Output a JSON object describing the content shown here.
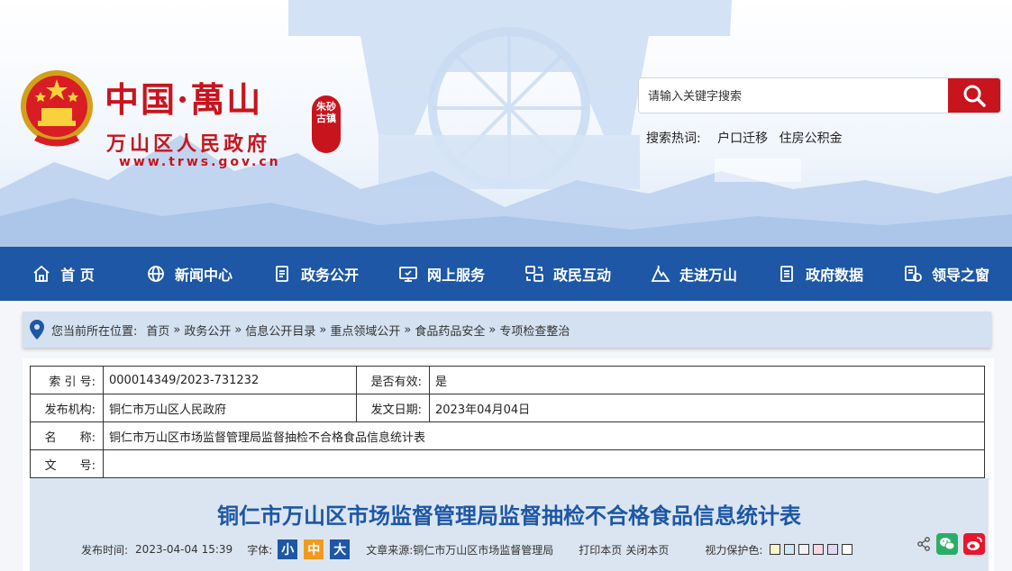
{
  "header": {
    "logo_title": "中国·萬山",
    "logo_seal": "朱砂古镇",
    "logo_subtitle": "万山区人民政府",
    "logo_url": "www.trws.gov.cn",
    "search": {
      "placeholder": "请输入关键字搜索",
      "hot_label": "搜索热词:",
      "hot_keywords": [
        "户口迁移",
        "住房公积金"
      ]
    }
  },
  "nav": {
    "items": [
      {
        "label": "首 页",
        "icon": "home-icon"
      },
      {
        "label": "新闻中心",
        "icon": "globe-icon"
      },
      {
        "label": "政务公开",
        "icon": "document-icon"
      },
      {
        "label": "网上服务",
        "icon": "monitor-icon"
      },
      {
        "label": "政民互动",
        "icon": "interaction-icon"
      },
      {
        "label": "走进万山",
        "icon": "mountain-icon"
      },
      {
        "label": "政府数据",
        "icon": "data-icon"
      },
      {
        "label": "领导之窗",
        "icon": "leader-icon"
      }
    ]
  },
  "breadcrumb": {
    "label": "您当前所在位置:",
    "items": [
      "首页",
      "政务公开",
      "信息公开目录",
      "重点领域公开",
      "食品药品安全",
      "专项检查整治"
    ],
    "separator": "»"
  },
  "meta": {
    "index_label": "索 引 号:",
    "index_value": "000014349/2023-731232",
    "valid_label": "是否有效:",
    "valid_value": "是",
    "org_label": "发布机构:",
    "org_value": "铜仁市万山区人民政府",
    "date_label": "发文日期:",
    "date_value": "2023年04月04日",
    "name_label": "名　　称:",
    "name_value": "铜仁市万山区市场监督管理局监督抽检不合格食品信息统计表",
    "doc_label": "文　　号:",
    "doc_value": ""
  },
  "article": {
    "title": "铜仁市万山区市场监督管理局监督抽检不合格食品信息统计表",
    "publish_label": "发布时间:",
    "publish_value": "2023-04-04 15:39",
    "font_label": "字体:",
    "font_small": "小",
    "font_medium": "中",
    "font_large": "大",
    "source_label": "文章来源:",
    "source_value": "铜仁市万山区市场监督管理局",
    "print_label": "打印本页",
    "close_label": "关闭本页",
    "eye_label": "视力保护色:",
    "eye_colors": [
      "#faf5c5",
      "#cfe7f7",
      "#f2f2f2",
      "#fbd6e2",
      "#e3d6f5",
      "#ffffff"
    ]
  },
  "colors": {
    "brand_red": "#c8141d",
    "nav_blue": "#1d57a5",
    "breadcrumb_bg": "#d3e1f1",
    "article_bg": "#dbe5f1",
    "wechat_green": "#2aae67",
    "weibo_red": "#e6162d"
  }
}
